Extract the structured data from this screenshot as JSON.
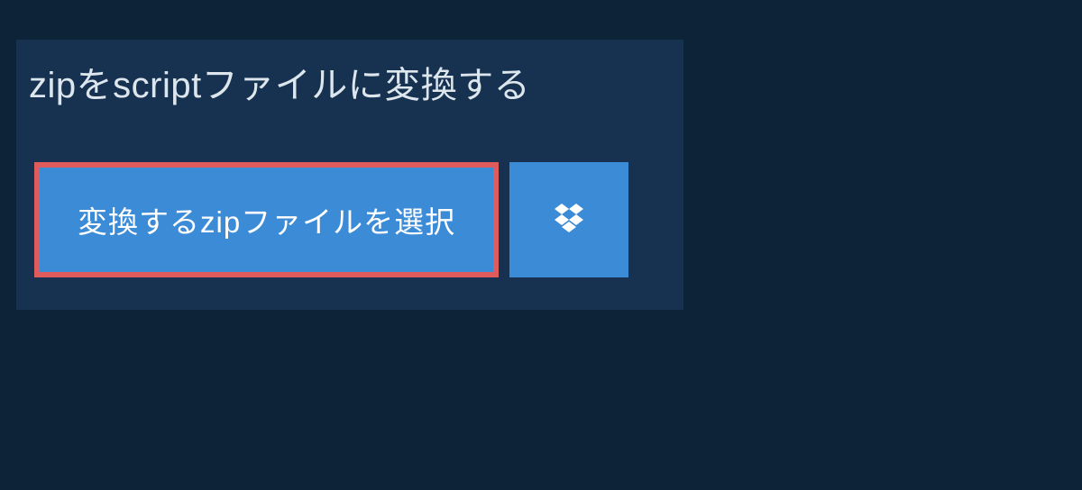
{
  "header": {
    "title": "zipをscriptファイルに変換する"
  },
  "actions": {
    "select_file_label": "変換するzipファイルを選択"
  },
  "colors": {
    "page_bg": "#0d2438",
    "panel_bg": "#163250",
    "button_bg": "#3b8bd6",
    "button_border": "#e05c5c",
    "text_light": "#dde6ed"
  }
}
